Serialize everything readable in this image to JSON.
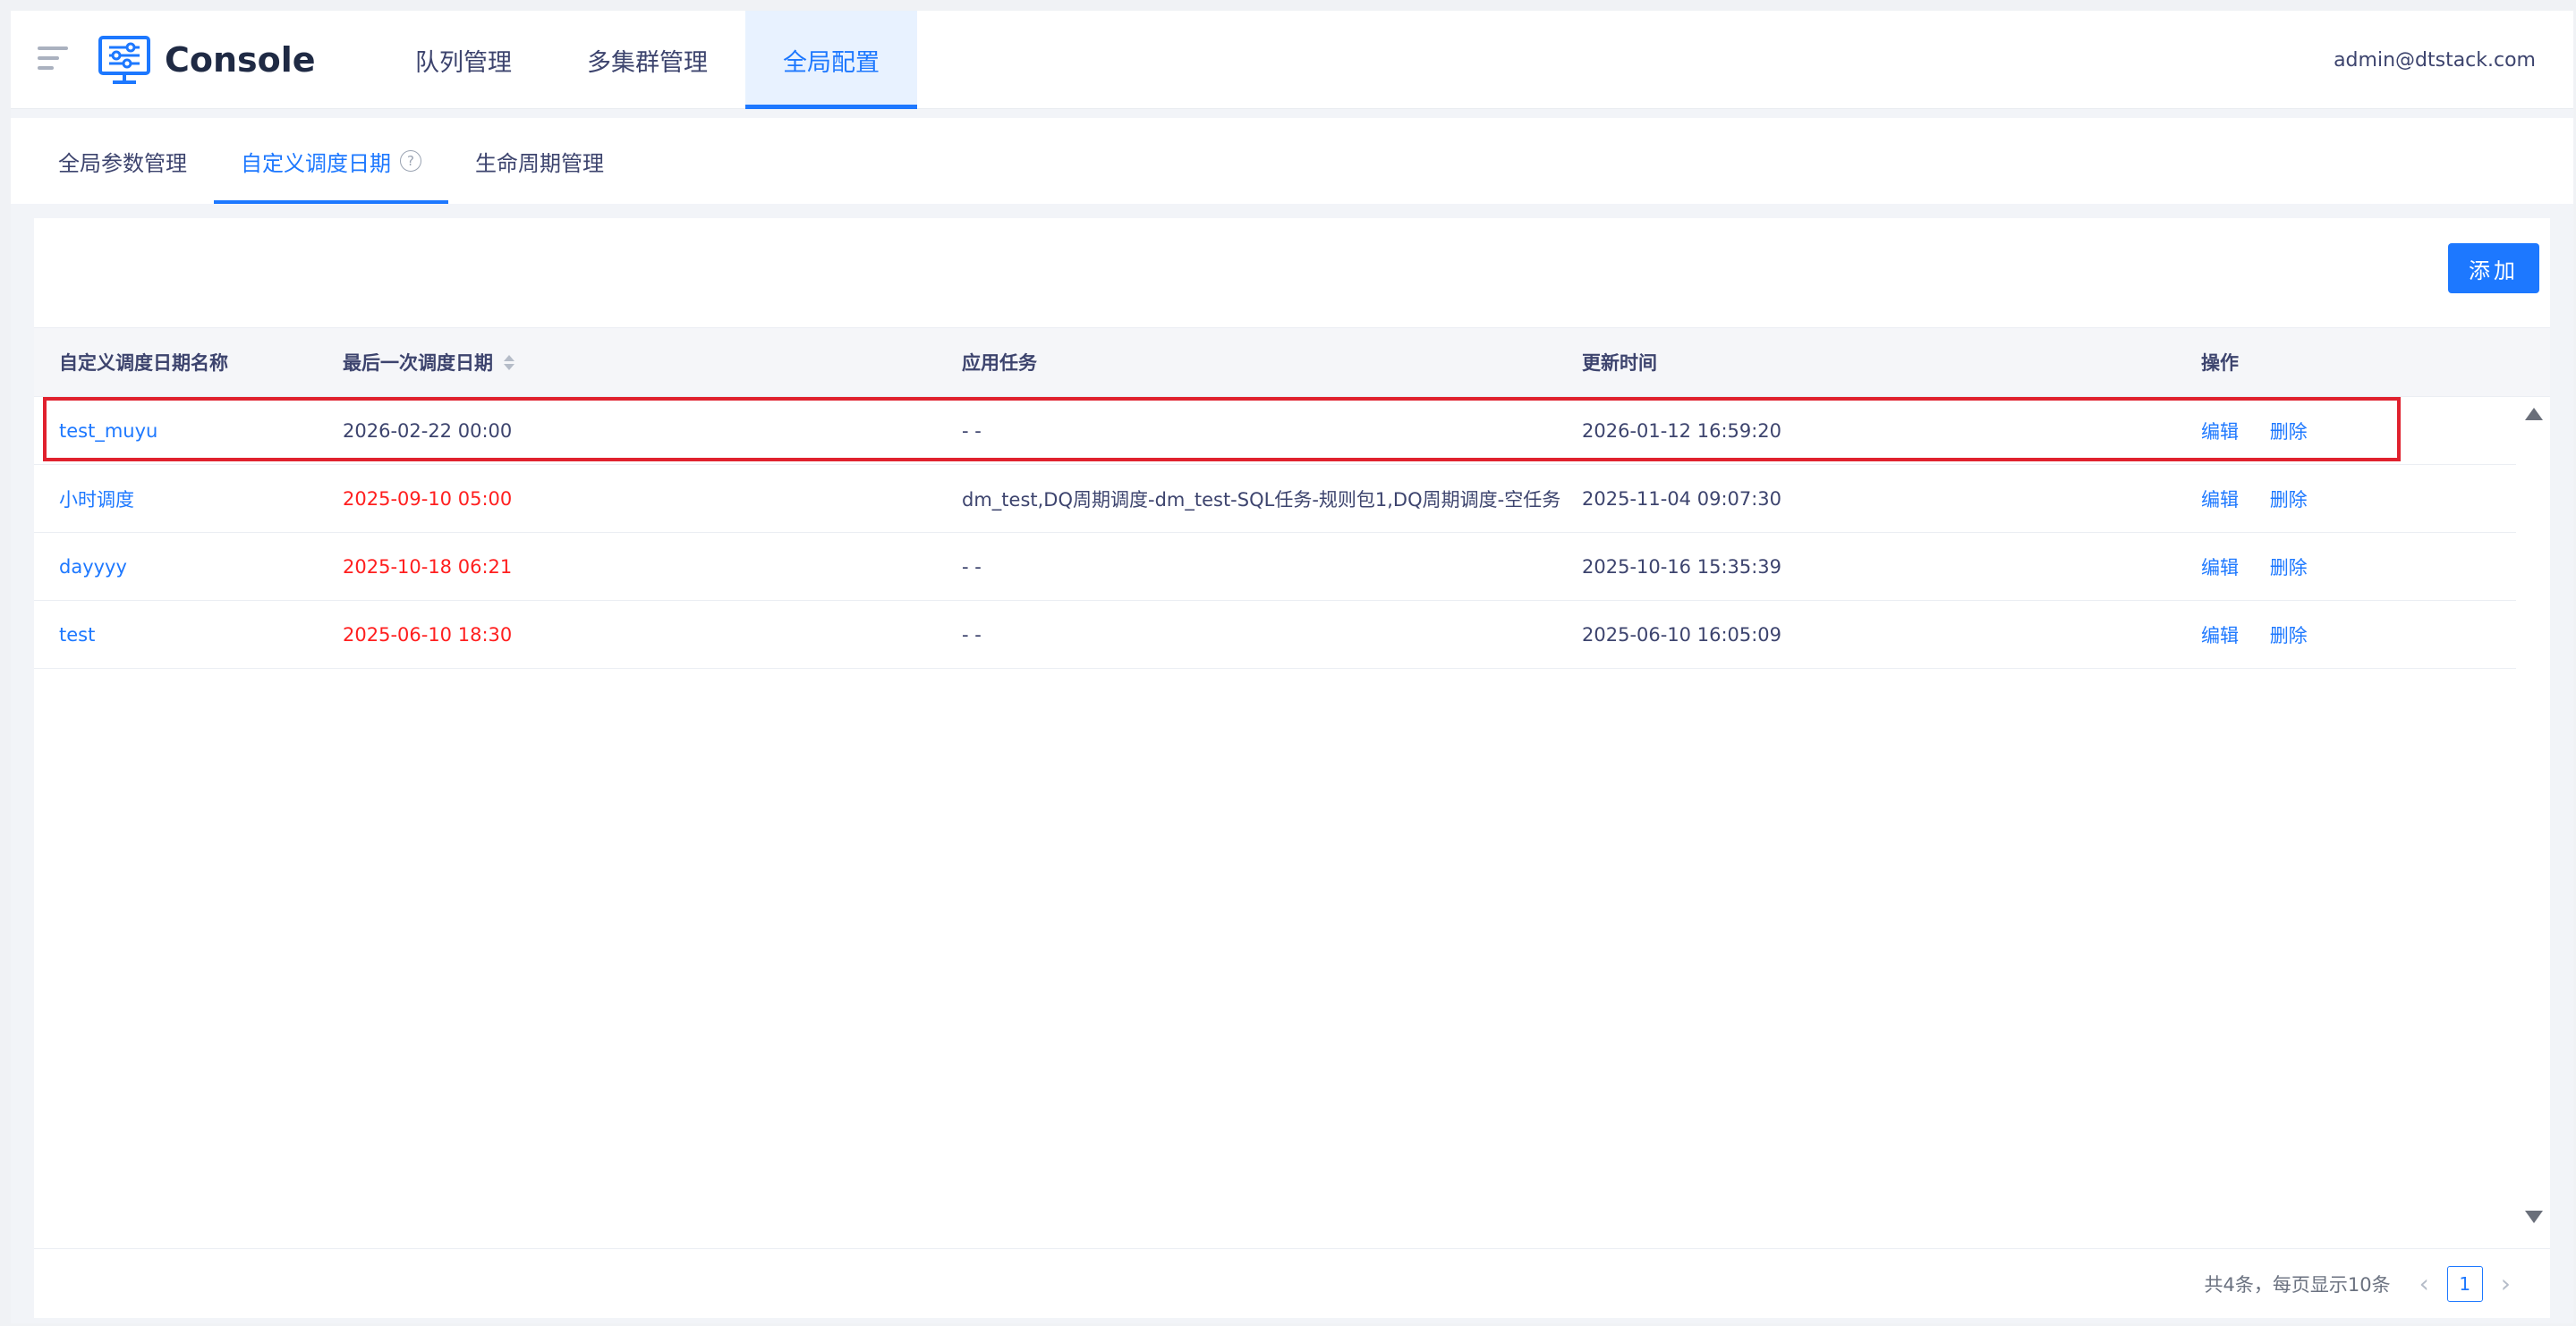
{
  "header": {
    "logo_text": "Console",
    "nav": [
      {
        "label": "队列管理"
      },
      {
        "label": "多集群管理"
      },
      {
        "label": "全局配置"
      }
    ],
    "user": "admin@dtstack.com"
  },
  "tabs": [
    {
      "label": "全局参数管理"
    },
    {
      "label": "自定义调度日期"
    },
    {
      "label": "生命周期管理"
    }
  ],
  "help_glyph": "?",
  "toolbar": {
    "add_label": "添加"
  },
  "table": {
    "columns": [
      "自定义调度日期名称",
      "最后一次调度日期",
      "应用任务",
      "更新时间",
      "操作"
    ],
    "rows": [
      {
        "name": "test_muyu",
        "last_date": "2026-02-22 00:00",
        "tasks": "- -",
        "updated": "2026-01-12 16:59:20",
        "edit": "编辑",
        "delete": "删除"
      },
      {
        "name": "小时调度",
        "last_date": "2025-09-10 05:00",
        "tasks": "dm_test,DQ周期调度-dm_test-SQL任务-规则包1,DQ周期调度-空任务",
        "updated": "2025-11-04 09:07:30",
        "edit": "编辑",
        "delete": "删除"
      },
      {
        "name": "dayyyy",
        "last_date": "2025-10-18 06:21",
        "tasks": "- -",
        "updated": "2025-10-16 15:35:39",
        "edit": "编辑",
        "delete": "删除"
      },
      {
        "name": "test",
        "last_date": "2025-06-10 18:30",
        "tasks": "- -",
        "updated": "2025-06-10 16:05:09",
        "edit": "编辑",
        "delete": "删除"
      }
    ]
  },
  "pagination": {
    "total_text": "共4条，每页显示10条",
    "current_page": "1",
    "prev": "‹",
    "next": "›"
  },
  "colors": {
    "accent": "#1d78ff",
    "expired_date": "#ff1f1f",
    "highlight_border": "#e0212e"
  }
}
